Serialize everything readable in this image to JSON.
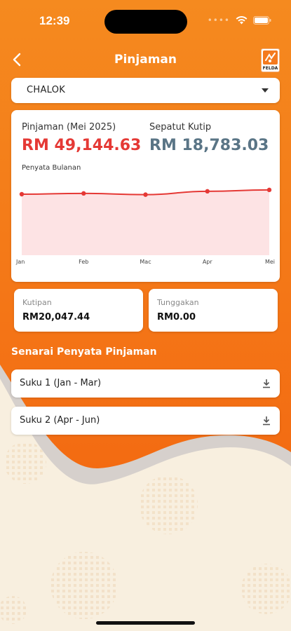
{
  "status": {
    "time": "12:39"
  },
  "header": {
    "title": "Pinjaman",
    "logo_text": "FELDA"
  },
  "dropdown": {
    "selected": "CHALOK"
  },
  "summary": {
    "loan_label": "Pinjaman (Mei 2025)",
    "loan_value": "RM 49,144.63",
    "target_label": "Sepatut Kutip",
    "target_value": "RM 18,783.03",
    "chart_title": "Penyata Bulanan"
  },
  "chart_data": {
    "type": "area",
    "categories": [
      "Jan",
      "Feb",
      "Mac",
      "Apr",
      "Mei"
    ],
    "series": [
      {
        "values": [
          49620,
          49750,
          49550,
          50080,
          50300
        ]
      }
    ],
    "ylim": [
      40000,
      51500
    ],
    "grid": false,
    "colors": {
      "line": "#e53935",
      "fill": "#fde3e4"
    }
  },
  "collected": {
    "label": "Kutipan",
    "value": "RM20,047.44"
  },
  "arrears": {
    "label": "Tunggakan",
    "value": "RM0.00"
  },
  "statements": {
    "title": "Senarai Penyata Pinjaman",
    "items": [
      {
        "label": "Suku 1 (Jan - Mar)"
      },
      {
        "label": "Suku 2 (Apr - Jun)"
      }
    ]
  },
  "colors": {
    "accent": "#f47a1f",
    "loan": "#e53935",
    "target": "#5a7586"
  }
}
